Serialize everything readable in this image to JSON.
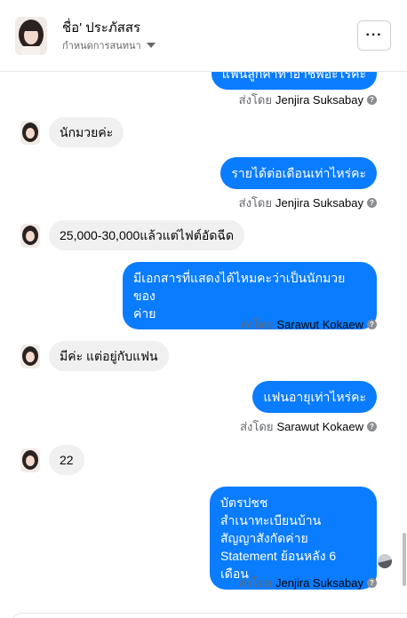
{
  "header": {
    "title": "ชื่อ' ประภัสสร",
    "subtitle": "กำหนดการสนทนา",
    "more_label": "···"
  },
  "thread": {
    "messages": [
      {
        "dir": "out",
        "text": "แฟนลูกค้าทำอาชีพอะไรคะ"
      },
      {
        "dir": "sent_by",
        "prefix": "ส่งโดย",
        "name": "Jenjira Suksabay"
      },
      {
        "dir": "in",
        "text": "นักมวยค่ะ"
      },
      {
        "dir": "out",
        "text": "รายได้ต่อเดือนเท่าไหร่คะ"
      },
      {
        "dir": "sent_by",
        "prefix": "ส่งโดย",
        "name": "Jenjira Suksabay"
      },
      {
        "dir": "in",
        "text": "25,000-30,000แล้วแต่ไฟต์อัดฉีด"
      },
      {
        "dir": "out",
        "lines": [
          "มีเอกสารที่แสดงได้ไหมคะว่าเป็นนักมวยของ",
          "ค่าย"
        ]
      },
      {
        "dir": "sent_by",
        "prefix": "ส่งโดย",
        "name": "Sarawut Kokaew"
      },
      {
        "dir": "in",
        "text": "มีค่ะ แต่อยู่กับแฟน"
      },
      {
        "dir": "out",
        "text": "แฟนอายุเท่าไหร่คะ"
      },
      {
        "dir": "sent_by",
        "prefix": "ส่งโดย",
        "name": "Sarawut Kokaew"
      },
      {
        "dir": "in",
        "text": "22"
      },
      {
        "dir": "out",
        "lines": [
          "บัตรปชช",
          "สำเนาทะเบียนบ้าน",
          "สัญญาสังกัดค่าย",
          "Statement ย้อนหลัง 6 เดือน"
        ]
      },
      {
        "dir": "sent_by",
        "prefix": "ส่งโดย",
        "name": "Jenjira Suksabay"
      }
    ]
  },
  "icons": {
    "info": "info-icon",
    "more": "more-dots-icon",
    "caret": "caret-down-icon"
  },
  "colors": {
    "outgoing_bubble": "#0a7cff",
    "incoming_bubble": "#f0f0f0",
    "meta_text": "#65676b"
  }
}
